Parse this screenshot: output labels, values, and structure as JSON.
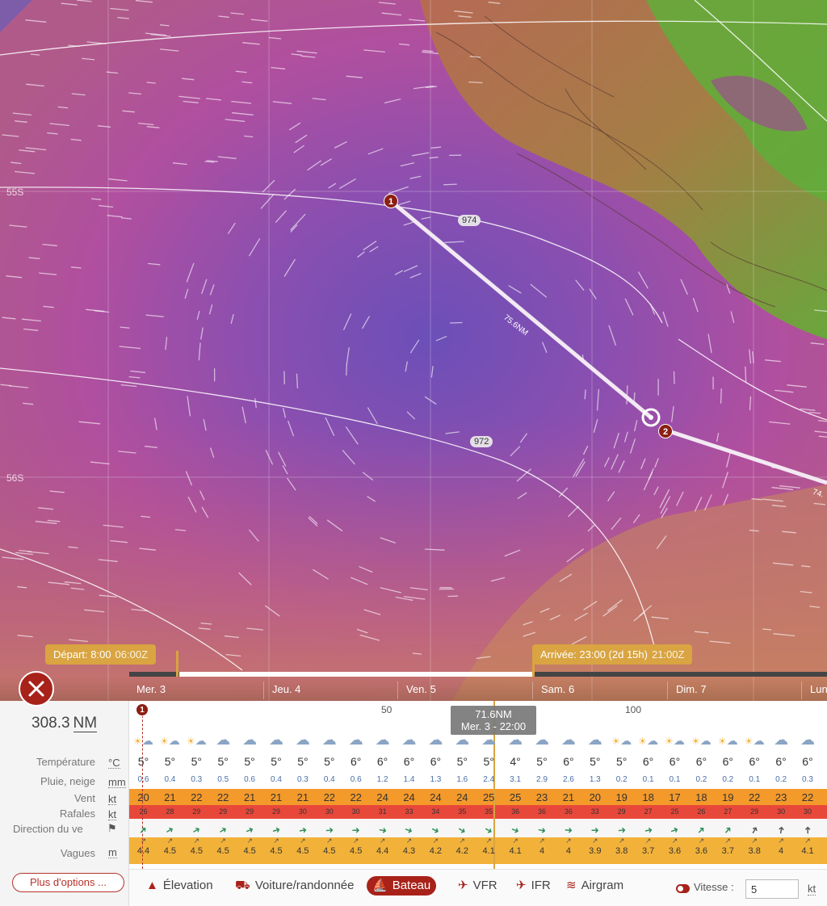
{
  "map": {
    "lat_labels": [
      "55S",
      "56S"
    ],
    "isobars": [
      "974",
      "972"
    ],
    "route": {
      "leg1_distance": "75.6NM",
      "leg2_distance": "74.",
      "waypoints": [
        "1",
        "2"
      ]
    }
  },
  "timeline": {
    "departure": {
      "label": "Départ: 8:00",
      "utc": "06:00Z"
    },
    "arrival": {
      "label": "Arrivée: 23:00 (2d 15h)",
      "utc": "21:00Z"
    },
    "days": [
      "Mer. 3",
      "Jeu. 4",
      "Ven. 5",
      "Sam. 6",
      "Dim. 7",
      "Lun"
    ]
  },
  "panel": {
    "total_distance": "308.3",
    "total_distance_unit": "NM",
    "distance_ticks": [
      "50",
      "100"
    ],
    "start_marker": "1",
    "tooltip": {
      "distance": "71.6NM",
      "time": "Mer. 3 - 22:00"
    },
    "rows": {
      "temperature": {
        "label": "Température",
        "unit": "°C"
      },
      "rain": {
        "label": "Pluie, neige",
        "unit": "mm"
      },
      "wind": {
        "label": "Vent",
        "unit": "kt"
      },
      "gusts": {
        "label": "Rafales",
        "unit": "kt"
      },
      "direction": {
        "label": "Direction du ve"
      },
      "waves": {
        "label": "Vagues",
        "unit": "m"
      }
    },
    "columns": [
      {
        "wx": "sun-snow",
        "t": "5°",
        "r": "0.6",
        "w": "20",
        "g": "26",
        "d": 45,
        "v": "4.4"
      },
      {
        "wx": "sun-snow",
        "t": "5°",
        "r": "0.4",
        "w": "21",
        "g": "28",
        "d": 60,
        "v": "4.5"
      },
      {
        "wx": "sun-snow",
        "t": "5°",
        "r": "0.3",
        "w": "22",
        "g": "29",
        "d": 60,
        "v": "4.5"
      },
      {
        "wx": "snow",
        "t": "5°",
        "r": "0.5",
        "w": "22",
        "g": "29",
        "d": 60,
        "v": "4.5"
      },
      {
        "wx": "snow",
        "t": "5°",
        "r": "0.6",
        "w": "21",
        "g": "29",
        "d": 70,
        "v": "4.5"
      },
      {
        "wx": "snow",
        "t": "5°",
        "r": "0.4",
        "w": "21",
        "g": "29",
        "d": 75,
        "v": "4.5"
      },
      {
        "wx": "snow",
        "t": "5°",
        "r": "0.3",
        "w": "21",
        "g": "30",
        "d": 80,
        "v": "4.5"
      },
      {
        "wx": "snow",
        "t": "5°",
        "r": "0.4",
        "w": "22",
        "g": "30",
        "d": 85,
        "v": "4.5"
      },
      {
        "wx": "snow",
        "t": "6°",
        "r": "0.6",
        "w": "22",
        "g": "30",
        "d": 90,
        "v": "4.5"
      },
      {
        "wx": "snow",
        "t": "6°",
        "r": "1.2",
        "w": "24",
        "g": "31",
        "d": 100,
        "v": "4.4"
      },
      {
        "wx": "snow",
        "t": "6°",
        "r": "1.4",
        "w": "24",
        "g": "33",
        "d": 110,
        "v": "4.3"
      },
      {
        "wx": "snow",
        "t": "6°",
        "r": "1.3",
        "w": "24",
        "g": "34",
        "d": 115,
        "v": "4.2"
      },
      {
        "wx": "snow",
        "t": "5°",
        "r": "1.6",
        "w": "24",
        "g": "35",
        "d": 120,
        "v": "4.2"
      },
      {
        "wx": "snow",
        "t": "5°",
        "r": "2.4",
        "w": "25",
        "g": "35",
        "d": 120,
        "v": "4.1"
      },
      {
        "wx": "snow",
        "t": "4°",
        "r": "3.1",
        "w": "25",
        "g": "36",
        "d": 110,
        "v": "4.1"
      },
      {
        "wx": "snow",
        "t": "5°",
        "r": "2.9",
        "w": "23",
        "g": "36",
        "d": 100,
        "v": "4"
      },
      {
        "wx": "snow",
        "t": "6°",
        "r": "2.6",
        "w": "21",
        "g": "36",
        "d": 95,
        "v": "4"
      },
      {
        "wx": "snow",
        "t": "5°",
        "r": "1.3",
        "w": "20",
        "g": "33",
        "d": 90,
        "v": "3.9"
      },
      {
        "wx": "sun-snow",
        "t": "5°",
        "r": "0.2",
        "w": "19",
        "g": "29",
        "d": 85,
        "v": "3.8"
      },
      {
        "wx": "sun-snow",
        "t": "6°",
        "r": "0.1",
        "w": "18",
        "g": "27",
        "d": 80,
        "v": "3.7"
      },
      {
        "wx": "sun-snow",
        "t": "6°",
        "r": "0.1",
        "w": "17",
        "g": "25",
        "d": 70,
        "v": "3.6"
      },
      {
        "wx": "sun-snow",
        "t": "6°",
        "r": "0.2",
        "w": "18",
        "g": "26",
        "d": 45,
        "v": "3.6"
      },
      {
        "wx": "sun-snow",
        "t": "6°",
        "r": "0.2",
        "w": "19",
        "g": "27",
        "d": 40,
        "v": "3.7"
      },
      {
        "wx": "sun-snow",
        "t": "6°",
        "r": "0.1",
        "w": "22",
        "g": "29",
        "d": 30,
        "v": "3.8"
      },
      {
        "wx": "snow",
        "t": "6°",
        "r": "0.2",
        "w": "23",
        "g": "30",
        "d": 10,
        "v": "4"
      },
      {
        "wx": "snow",
        "t": "6°",
        "r": "0.3",
        "w": "22",
        "g": "30",
        "d": 0,
        "v": "4.1"
      }
    ]
  },
  "options_label": "Plus d'options ...",
  "modes": [
    {
      "icon": "mountain-icon",
      "glyph": "▲",
      "label": "Élevation",
      "active": false
    },
    {
      "icon": "car-icon",
      "glyph": "⛟",
      "label": "Voiture/randonnée",
      "active": false
    },
    {
      "icon": "boat-icon",
      "glyph": "⛵",
      "label": "Bateau",
      "active": true
    },
    {
      "icon": "helicopter-icon",
      "glyph": "✈",
      "label": "VFR",
      "active": false
    },
    {
      "icon": "plane-icon",
      "glyph": "✈",
      "label": "IFR",
      "active": false
    },
    {
      "icon": "airgram-icon",
      "glyph": "≋",
      "label": "Airgram",
      "active": false
    }
  ],
  "speed": {
    "label": "Vitesse :",
    "value": "5",
    "unit": "kt"
  },
  "colors": {
    "accent": "#a8221a",
    "tag": "#d9a441",
    "wind_band": "#f39a2b",
    "gust_band": "#e8483a",
    "wave_band": "#f2b23a"
  }
}
